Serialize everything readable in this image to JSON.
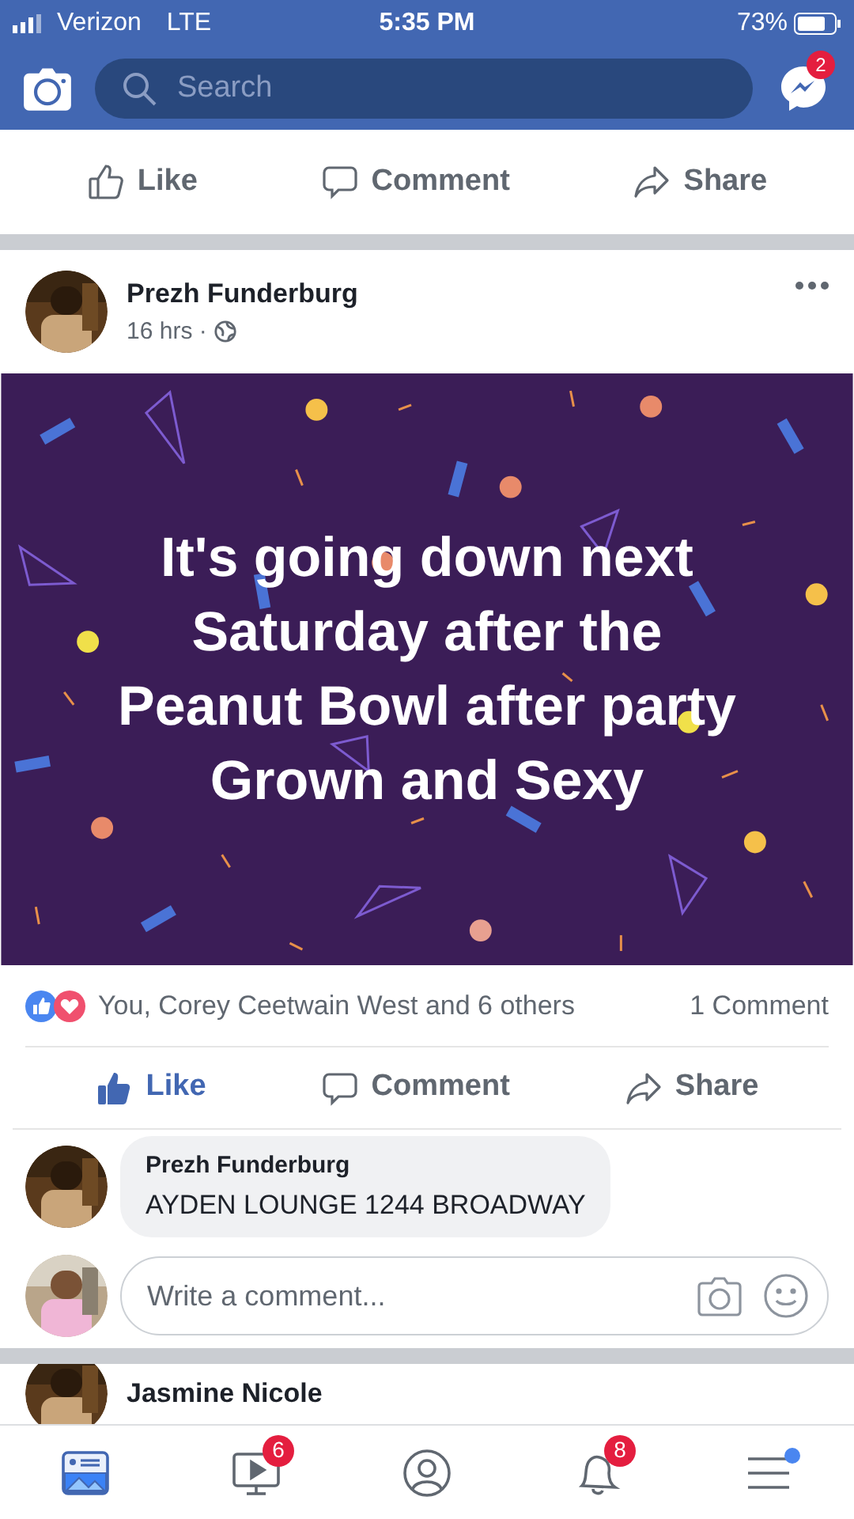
{
  "status_bar": {
    "carrier": "Verizon",
    "network": "LTE",
    "time": "5:35 PM",
    "battery": "73%"
  },
  "top_bar": {
    "search": {
      "placeholder": "Search"
    },
    "messenger_badge": "2"
  },
  "previous_post_actions": [
    {
      "kind": "like",
      "label": "Like",
      "liked": false
    },
    {
      "kind": "comment",
      "label": "Comment"
    },
    {
      "kind": "share",
      "label": "Share"
    }
  ],
  "post": {
    "author": "Prezh Funderburg",
    "time": "16 hrs ·",
    "text_lines": [
      "It's going down next",
      "Saturday after the",
      "Peanut Bowl after party",
      "Grown and Sexy"
    ],
    "reactions": "You, Corey Ceetwain West and 6 others",
    "comment_count": "1 Comment",
    "actions": [
      {
        "kind": "like",
        "label": "Like",
        "liked": true
      },
      {
        "kind": "comment",
        "label": "Comment"
      },
      {
        "kind": "share",
        "label": "Share"
      }
    ],
    "comment": {
      "author": "Prezh Funderburg",
      "text": "AYDEN LOUNGE 1244 BROADWAY"
    },
    "write_comment": {
      "placeholder": "Write a comment..."
    }
  },
  "next_post": {
    "author": "Jasmine Nicole"
  },
  "tab_bar": [
    {
      "kind": "feed",
      "selected": true
    },
    {
      "kind": "video",
      "selected": false,
      "badge": "6"
    },
    {
      "kind": "profile",
      "selected": false
    },
    {
      "kind": "notifications",
      "selected": false,
      "badge": "8"
    },
    {
      "kind": "menu",
      "selected": false,
      "dot": true
    }
  ]
}
